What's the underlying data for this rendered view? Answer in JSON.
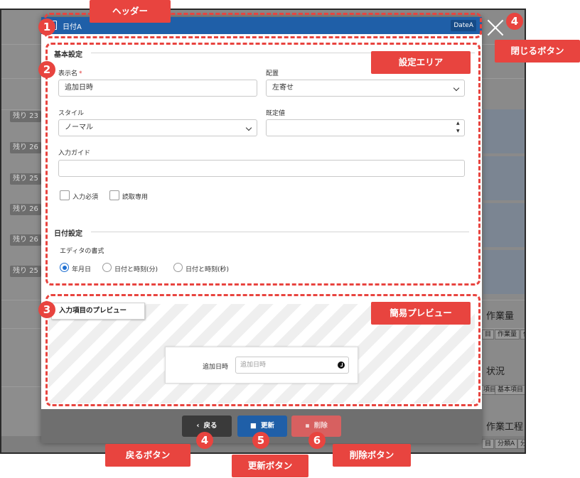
{
  "background": {
    "remaining_badges": [
      "残り 23",
      "残り 26",
      "残り 25",
      "残り 26",
      "残り 26",
      "残り 25"
    ],
    "right_panel": {
      "work_amount": "作業量",
      "chips_row1": [
        "目",
        "作業量",
        "作"
      ],
      "status": "状況",
      "chips_row2": [
        "項目",
        "基本項目"
      ],
      "work_process": "作業工程",
      "chips_row3": [
        "目",
        "分類A",
        "分"
      ]
    }
  },
  "modal": {
    "header": {
      "title": "日付A",
      "code": "DateA"
    },
    "basic_settings": {
      "title": "基本設定",
      "display_name": {
        "label": "表示名",
        "required_mark": "*",
        "value": "追加日時"
      },
      "alignment": {
        "label": "配置",
        "value": "左寄せ"
      },
      "style": {
        "label": "スタイル",
        "value": "ノーマル"
      },
      "default_value": {
        "label": "既定値",
        "value": ""
      },
      "input_guide": {
        "label": "入力ガイド",
        "value": ""
      },
      "required_checkbox": "入力必須",
      "readonly_checkbox": "読取専用"
    },
    "date_settings": {
      "title": "日付設定",
      "editor_format_label": "エディタの書式",
      "options": [
        "年月日",
        "日付と時刻(分)",
        "日付と時刻(秒)"
      ],
      "selected_index": 0
    },
    "preview": {
      "tab_label": "入力項目のプレビュー",
      "field_label": "追加日時",
      "field_placeholder": "追加日時"
    },
    "footer": {
      "back_label": "戻る",
      "update_label": "更新",
      "delete_label": "削除"
    }
  },
  "annotations": {
    "header_label": "ヘッダー",
    "close_label": "閉じるボタン",
    "settings_area_label": "設定エリア",
    "preview_label": "簡易プレビュー",
    "back_button_label": "戻るボタン",
    "update_button_label": "更新ボタン",
    "delete_button_label": "削除ボタン",
    "badges": [
      "1",
      "2",
      "3",
      "4",
      "4",
      "5",
      "6"
    ]
  },
  "colors": {
    "header_blue": "#1f5fa8",
    "annotation_red": "#e8443f",
    "delete_red": "#d76060",
    "back_dark": "#3a3a3a"
  }
}
